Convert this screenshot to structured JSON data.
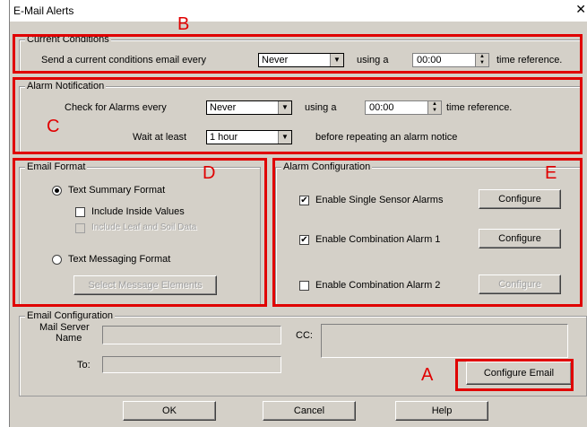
{
  "window": {
    "title": "E-Mail Alerts",
    "close_glyph": "✕"
  },
  "current_conditions": {
    "legend": "Current Conditions",
    "prefix": "Send a current conditions  email every",
    "interval": "Never",
    "using": "using a",
    "time": "00:00",
    "suffix": "time reference."
  },
  "alarm_notification": {
    "legend": "Alarm Notification",
    "check_label": "Check for Alarms every",
    "check_interval": "Never",
    "using": "using a",
    "time": "00:00",
    "suffix": "time reference.",
    "wait_label": "Wait at least",
    "wait_value": "1 hour",
    "wait_suffix": "before repeating an alarm notice"
  },
  "email_format": {
    "legend": "Email Format",
    "text_summary": {
      "label": "Text Summary Format",
      "selected": true
    },
    "include_inside": {
      "label": "Include Inside Values",
      "checked": false
    },
    "include_leaf": {
      "label": "Include Leaf and Soil Data",
      "checked": false,
      "disabled": true
    },
    "text_messaging": {
      "label": "Text Messaging Format",
      "selected": false
    },
    "select_elements": "Select Message Elements"
  },
  "alarm_configuration": {
    "legend": "Alarm Configuration",
    "items": [
      {
        "label": "Enable Single Sensor Alarms",
        "checked": true,
        "button": "Configure",
        "button_enabled": true
      },
      {
        "label": "Enable Combination Alarm 1",
        "checked": true,
        "button": "Configure",
        "button_enabled": true
      },
      {
        "label": "Enable Combination Alarm 2",
        "checked": false,
        "button": "Configure",
        "button_enabled": false
      }
    ]
  },
  "email_configuration": {
    "legend": "Email Configuration",
    "mail_server_label_1": "Mail Server",
    "mail_server_label_2": "Name",
    "mail_server_value": "",
    "cc_label": "CC:",
    "cc_value": "",
    "to_label": "To:",
    "to_value": "",
    "configure_email": "Configure Email"
  },
  "footer": {
    "ok": "OK",
    "cancel": "Cancel",
    "help": "Help"
  },
  "annotations": {
    "color": "#e00000",
    "labels": {
      "A": "A",
      "B": "B",
      "C": "C",
      "D": "D",
      "E": "E"
    }
  },
  "check_glyph": "✔"
}
